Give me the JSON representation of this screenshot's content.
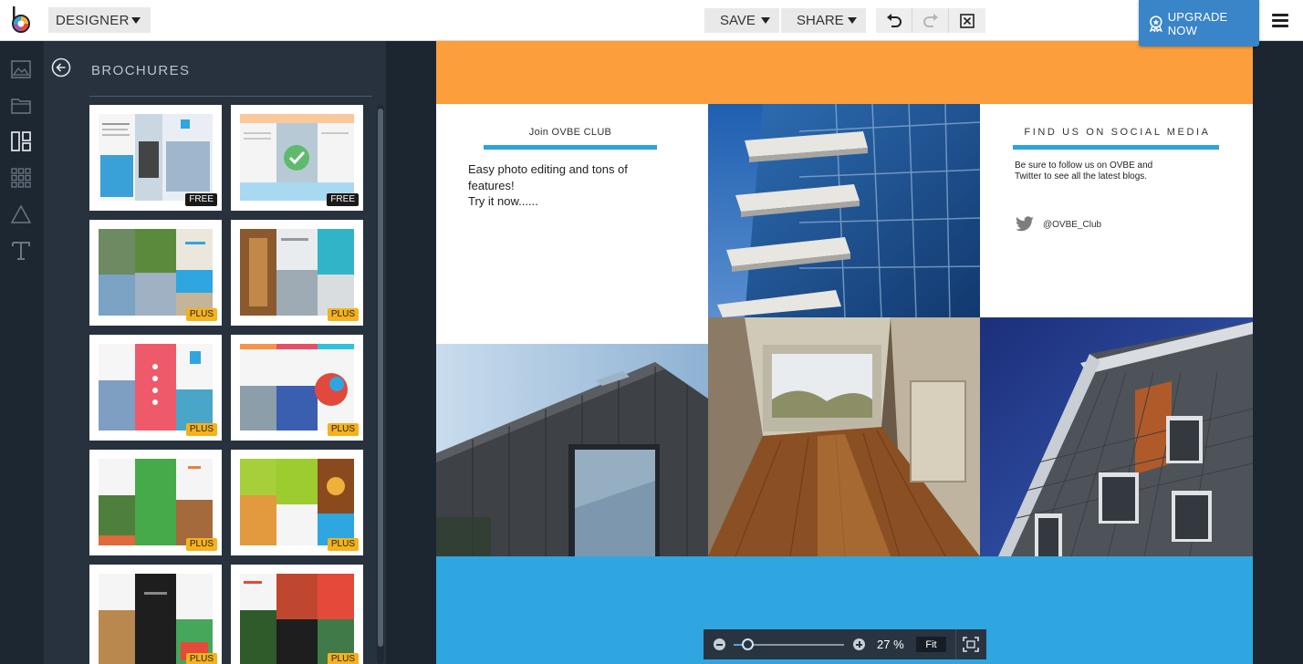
{
  "app": {
    "mode_label": "DESIGNER",
    "save_label": "SAVE",
    "share_label": "SHARE",
    "upgrade_label": "UPGRADE NOW",
    "accent_color": "#3a84c8"
  },
  "rail": {
    "items": [
      {
        "name": "photo-icon"
      },
      {
        "name": "folder-icon"
      },
      {
        "name": "templates-icon",
        "active": true
      },
      {
        "name": "grid-icon"
      },
      {
        "name": "shapes-triangle-icon"
      },
      {
        "name": "text-icon"
      }
    ]
  },
  "panel": {
    "title": "BROCHURES",
    "templates": [
      {
        "badge": "FREE"
      },
      {
        "badge": "FREE",
        "selected": true
      },
      {
        "badge": "PLUS"
      },
      {
        "badge": "PLUS"
      },
      {
        "badge": "PLUS"
      },
      {
        "badge": "PLUS"
      },
      {
        "badge": "PLUS"
      },
      {
        "badge": "PLUS"
      },
      {
        "badge": "PLUS"
      },
      {
        "badge": "PLUS"
      }
    ]
  },
  "document": {
    "join": {
      "title": "Join OVBE CLUB",
      "line1": "Easy photo editing and tons of",
      "line2": "features!",
      "line3": "Try it now......"
    },
    "social": {
      "title": "FIND US ON SOCIAL MEDIA",
      "line1": "Be sure to follow us on OVBE and",
      "line2": "Twitter to see all the latest blogs.",
      "handle": "@OVBE_Club"
    },
    "colors": {
      "top_band": "#fb9e3b",
      "bottom_band": "#2fa6df",
      "rule": "#2ba4dc"
    }
  },
  "zoom": {
    "value_label": "27 %",
    "value": 27,
    "slider_fraction": 0.13,
    "fit_label": "Fit"
  }
}
